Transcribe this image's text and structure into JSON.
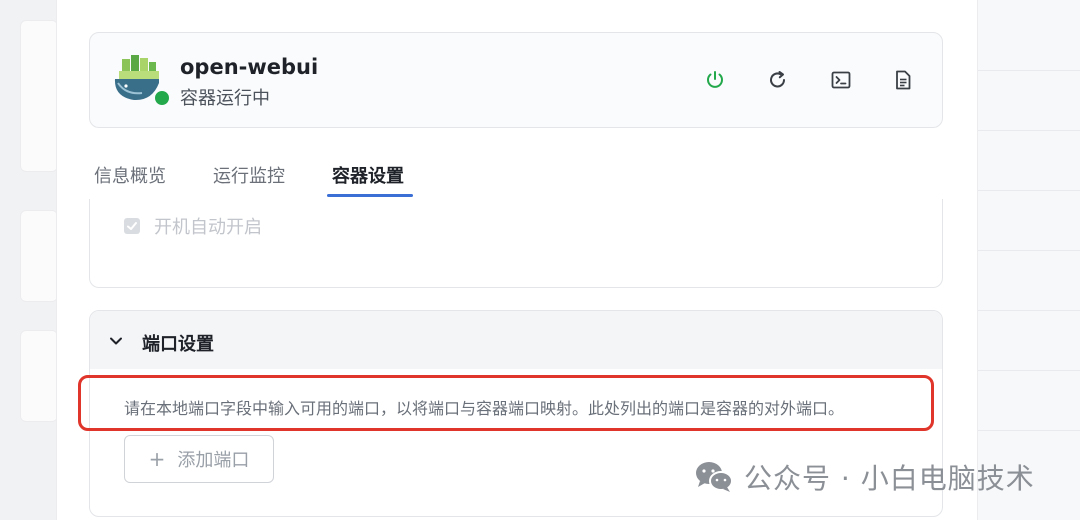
{
  "app": {
    "name": "open-webui",
    "status": "容器运行中",
    "status_color": "#23a94c"
  },
  "header_actions": [
    {
      "icon": "power-icon",
      "color": "#23a94c"
    },
    {
      "icon": "restart-icon",
      "color": "#3a3f46"
    },
    {
      "icon": "terminal-icon",
      "color": "#3a3f46"
    },
    {
      "icon": "logs-icon",
      "color": "#3a3f46"
    }
  ],
  "tabs": [
    {
      "label": "信息概览",
      "active": false
    },
    {
      "label": "运行监控",
      "active": false
    },
    {
      "label": "容器设置",
      "active": true
    }
  ],
  "startup": {
    "label": "开机自动开启",
    "checked": true,
    "disabled": true
  },
  "ports": {
    "section_title": "端口设置",
    "expanded": true,
    "description": "请在本地端口字段中输入可用的端口，以将端口与容器端口映射。此处列出的端口是容器的对外端口。",
    "add_button": "添加端口"
  },
  "colors": {
    "accent": "#3b6fd6",
    "highlight": "#e0352b"
  },
  "watermark": {
    "text": "公众号 · 小白电脑技术"
  }
}
